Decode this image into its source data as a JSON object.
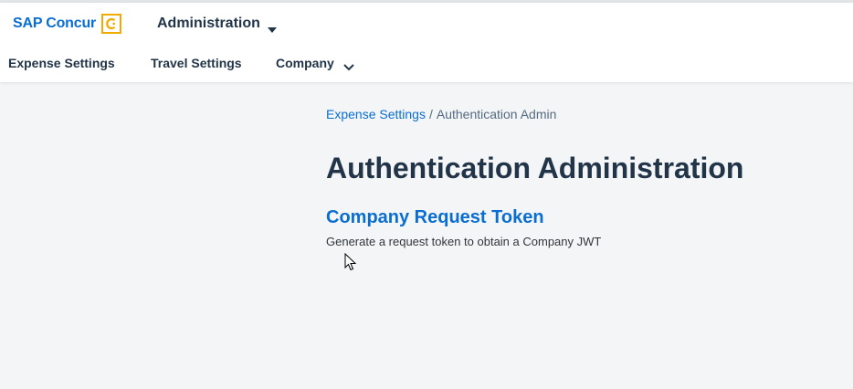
{
  "header": {
    "logo_text": "SAP Concur",
    "logo_icon": "concur-c-logo-icon",
    "app_menu_label": "Administration",
    "app_menu_icon": "caret-down-icon"
  },
  "nav": {
    "items": [
      {
        "label": "Expense Settings"
      },
      {
        "label": "Travel Settings"
      },
      {
        "label": "Company",
        "icon": "chevron-down-icon"
      }
    ]
  },
  "breadcrumb": {
    "parent": "Expense Settings",
    "separator": "/",
    "current": "Authentication Admin"
  },
  "page": {
    "title": "Authentication Administration",
    "section_link": "Company Request Token",
    "section_description": "Generate a request token to obtain a Company JWT"
  },
  "colors": {
    "brand_blue": "#0a6ed1",
    "logo_gold": "#f0ab00",
    "text_dark": "#223548",
    "background": "#f4f5f7"
  }
}
